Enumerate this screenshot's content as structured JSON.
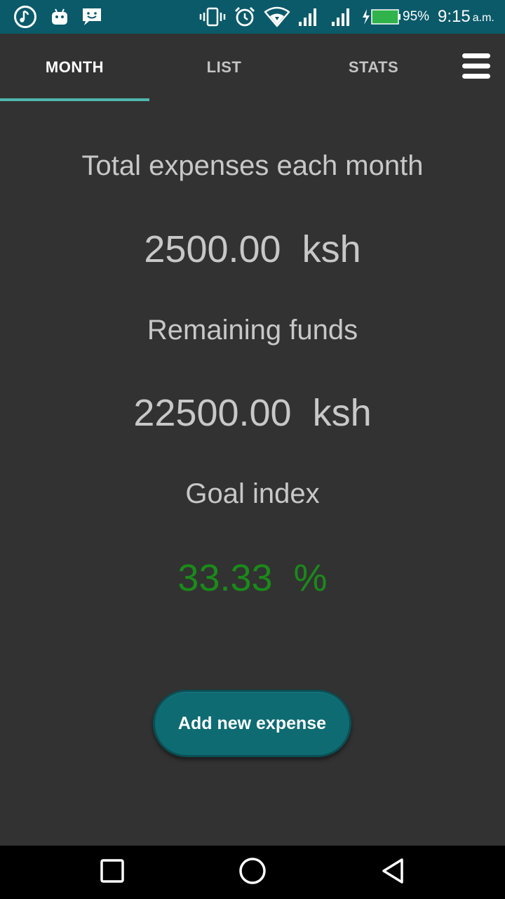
{
  "status_bar": {
    "notification_icons": [
      "music-note-icon",
      "android-icon",
      "chat-bubble-icon"
    ],
    "system_icons": [
      "vibrate-icon",
      "alarm-icon",
      "wifi-icon",
      "signal-icon",
      "signal-icon",
      "battery-charging-icon"
    ],
    "battery_percent": "95%",
    "time": "9:15",
    "ampm": "a.m."
  },
  "tabs": [
    {
      "label": "MONTH",
      "active": true
    },
    {
      "label": "LIST",
      "active": false
    },
    {
      "label": "STATS",
      "active": false
    }
  ],
  "menu_icon": "hamburger-menu-icon",
  "summary": {
    "total_label": "Total expenses each month",
    "total_value": "2500.00  ksh",
    "remaining_label": "Remaining funds",
    "remaining_value": "22500.00  ksh",
    "goal_label": "Goal index",
    "goal_value": "33.33  %"
  },
  "add_button_label": "Add new expense",
  "nav_bar": {
    "buttons": [
      "recent-apps-icon",
      "home-icon",
      "back-icon"
    ]
  },
  "colors": {
    "status_bar": "#0a5a6a",
    "background": "#323232",
    "tab_indicator": "#4fb6ad",
    "goal_value": "#1a8a1a",
    "button": "#0e6b72"
  }
}
